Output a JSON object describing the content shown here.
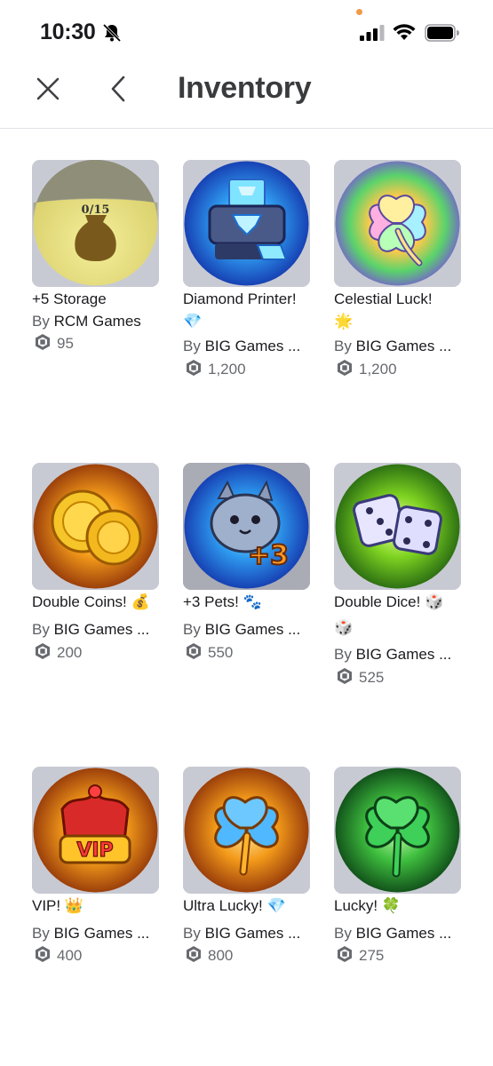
{
  "status_bar": {
    "time": "10:30"
  },
  "header": {
    "title": "Inventory"
  },
  "items": [
    {
      "name": "+5 Storage",
      "emoji": "",
      "by": "By ",
      "creator": "RCM Games",
      "price": "95"
    },
    {
      "name": "Diamond Printer!",
      "emoji": "💎",
      "by": "By ",
      "creator": "BIG Games ...",
      "price": "1,200"
    },
    {
      "name": "Celestial Luck!",
      "emoji": "🌟",
      "by": "By ",
      "creator": "BIG Games ...",
      "price": "1,200"
    },
    {
      "name": "Double Coins! 💰",
      "emoji": "",
      "by": "By ",
      "creator": "BIG Games ...",
      "price": "200"
    },
    {
      "name": "+3 Pets! 🐾",
      "emoji": "",
      "by": "By ",
      "creator": "BIG Games ...",
      "price": "550"
    },
    {
      "name": "Double Dice! 🎲",
      "emoji": "🎲",
      "by": "By ",
      "creator": "BIG Games ...",
      "price": "525"
    },
    {
      "name": "VIP! 👑",
      "emoji": "",
      "by": "By ",
      "creator": "BIG Games ...",
      "price": "400"
    },
    {
      "name": "Ultra Lucky! 💎",
      "emoji": "",
      "by": "By ",
      "creator": "BIG Games ...",
      "price": "800"
    },
    {
      "name": "Lucky! 🍀",
      "emoji": "",
      "by": "By ",
      "creator": "BIG Games ...",
      "price": "275"
    }
  ],
  "thumb_labels": {
    "storage_counter": "0/15",
    "vip_badge": "VIP",
    "pets_badge": "+3"
  },
  "colors": {
    "robux_gray": "#686a70",
    "thumb_bg": "#c8cad3",
    "divider": "#e2e3e6"
  },
  "icons": [
    "bell-slash-icon",
    "signal-icon",
    "wifi-icon",
    "battery-icon",
    "close-icon",
    "chevron-left-icon",
    "robux-icon"
  ]
}
